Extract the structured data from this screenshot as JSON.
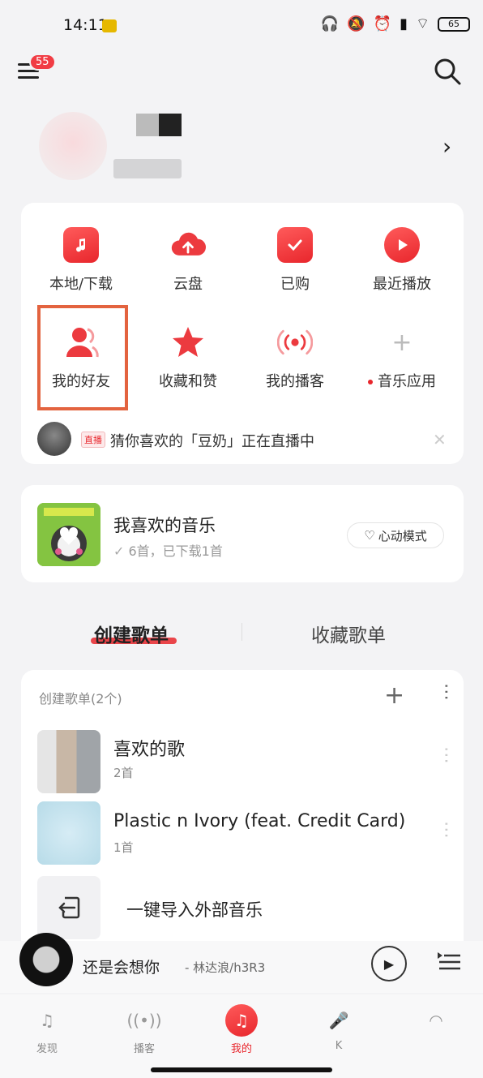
{
  "status": {
    "time": "14:11",
    "battery": "65"
  },
  "header": {
    "badge": "55"
  },
  "grid": {
    "row1": [
      {
        "label": "本地/下载"
      },
      {
        "label": "云盘"
      },
      {
        "label": "已购"
      },
      {
        "label": "最近播放"
      }
    ],
    "row2": [
      {
        "label": "我的好友"
      },
      {
        "label": "收藏和赞"
      },
      {
        "label": "我的播客"
      },
      {
        "label": "音乐应用"
      }
    ]
  },
  "live": {
    "tag": "直播",
    "text": "猜你喜欢的「豆奶」正在直播中"
  },
  "liked": {
    "title": "我喜欢的音乐",
    "sub": "6首，已下载1首",
    "mode": "心动模式"
  },
  "tabs": {
    "create": "创建歌单",
    "collect": "收藏歌单"
  },
  "playlists": {
    "header": "创建歌单(2个)",
    "items": [
      {
        "title": "喜欢的歌",
        "count": "2首"
      },
      {
        "title": "Plastic n Ivory (feat. Credit Card)",
        "count": "1首"
      }
    ],
    "import_label": "一键导入外部音乐"
  },
  "player": {
    "title": "还是会想你",
    "artist": "- 林达浪/h3R3"
  },
  "nav": [
    {
      "label": "发现"
    },
    {
      "label": "播客"
    },
    {
      "label": "我的"
    },
    {
      "label": "K"
    },
    {
      "label": ""
    }
  ],
  "colors": {
    "accent": "#e8262c",
    "highlight": "#e3633f"
  }
}
